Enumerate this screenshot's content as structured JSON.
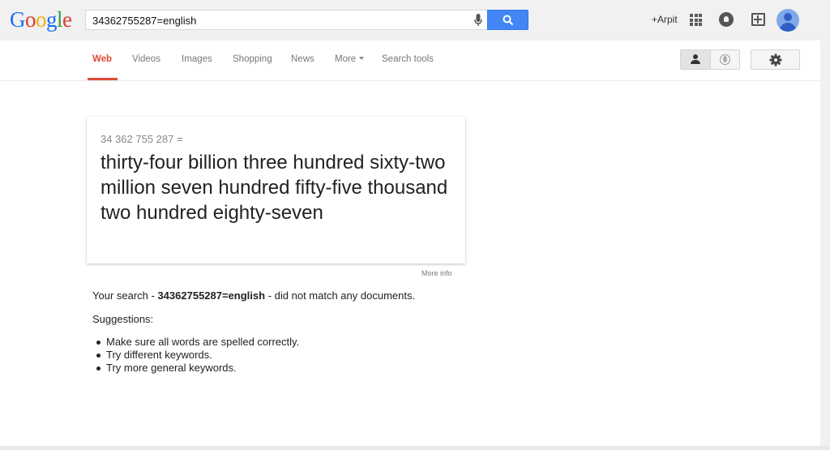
{
  "logo": [
    "G",
    "o",
    "o",
    "g",
    "l",
    "e"
  ],
  "search": {
    "value": "34362755287=english"
  },
  "header": {
    "user": "+Arpit"
  },
  "tabs": [
    {
      "label": "Web"
    },
    {
      "label": "Videos"
    },
    {
      "label": "Images"
    },
    {
      "label": "Shopping"
    },
    {
      "label": "News"
    },
    {
      "label": "More"
    },
    {
      "label": "Search tools"
    }
  ],
  "answer": {
    "equation": "34 362 755 287 =",
    "words": "thirty-four billion three hundred sixty-two million seven hundred fifty-five thousand two hundred eighty-seven",
    "more_info": "More info"
  },
  "result": {
    "prefix": "Your search - ",
    "query": "34362755287=english",
    "suffix": " - did not match any documents."
  },
  "suggestions": {
    "title": "Suggestions:",
    "items": [
      "Make sure all words are spelled correctly.",
      "Try different keywords.",
      "Try more general keywords."
    ]
  },
  "colors": {
    "accent_red": "#dd4b39",
    "search_blue": "#4285f4"
  },
  "icons": [
    "mic-icon",
    "search-icon",
    "apps-icon",
    "notifications-icon",
    "share-icon",
    "avatar",
    "person-icon",
    "globe-icon",
    "gear-icon"
  ]
}
